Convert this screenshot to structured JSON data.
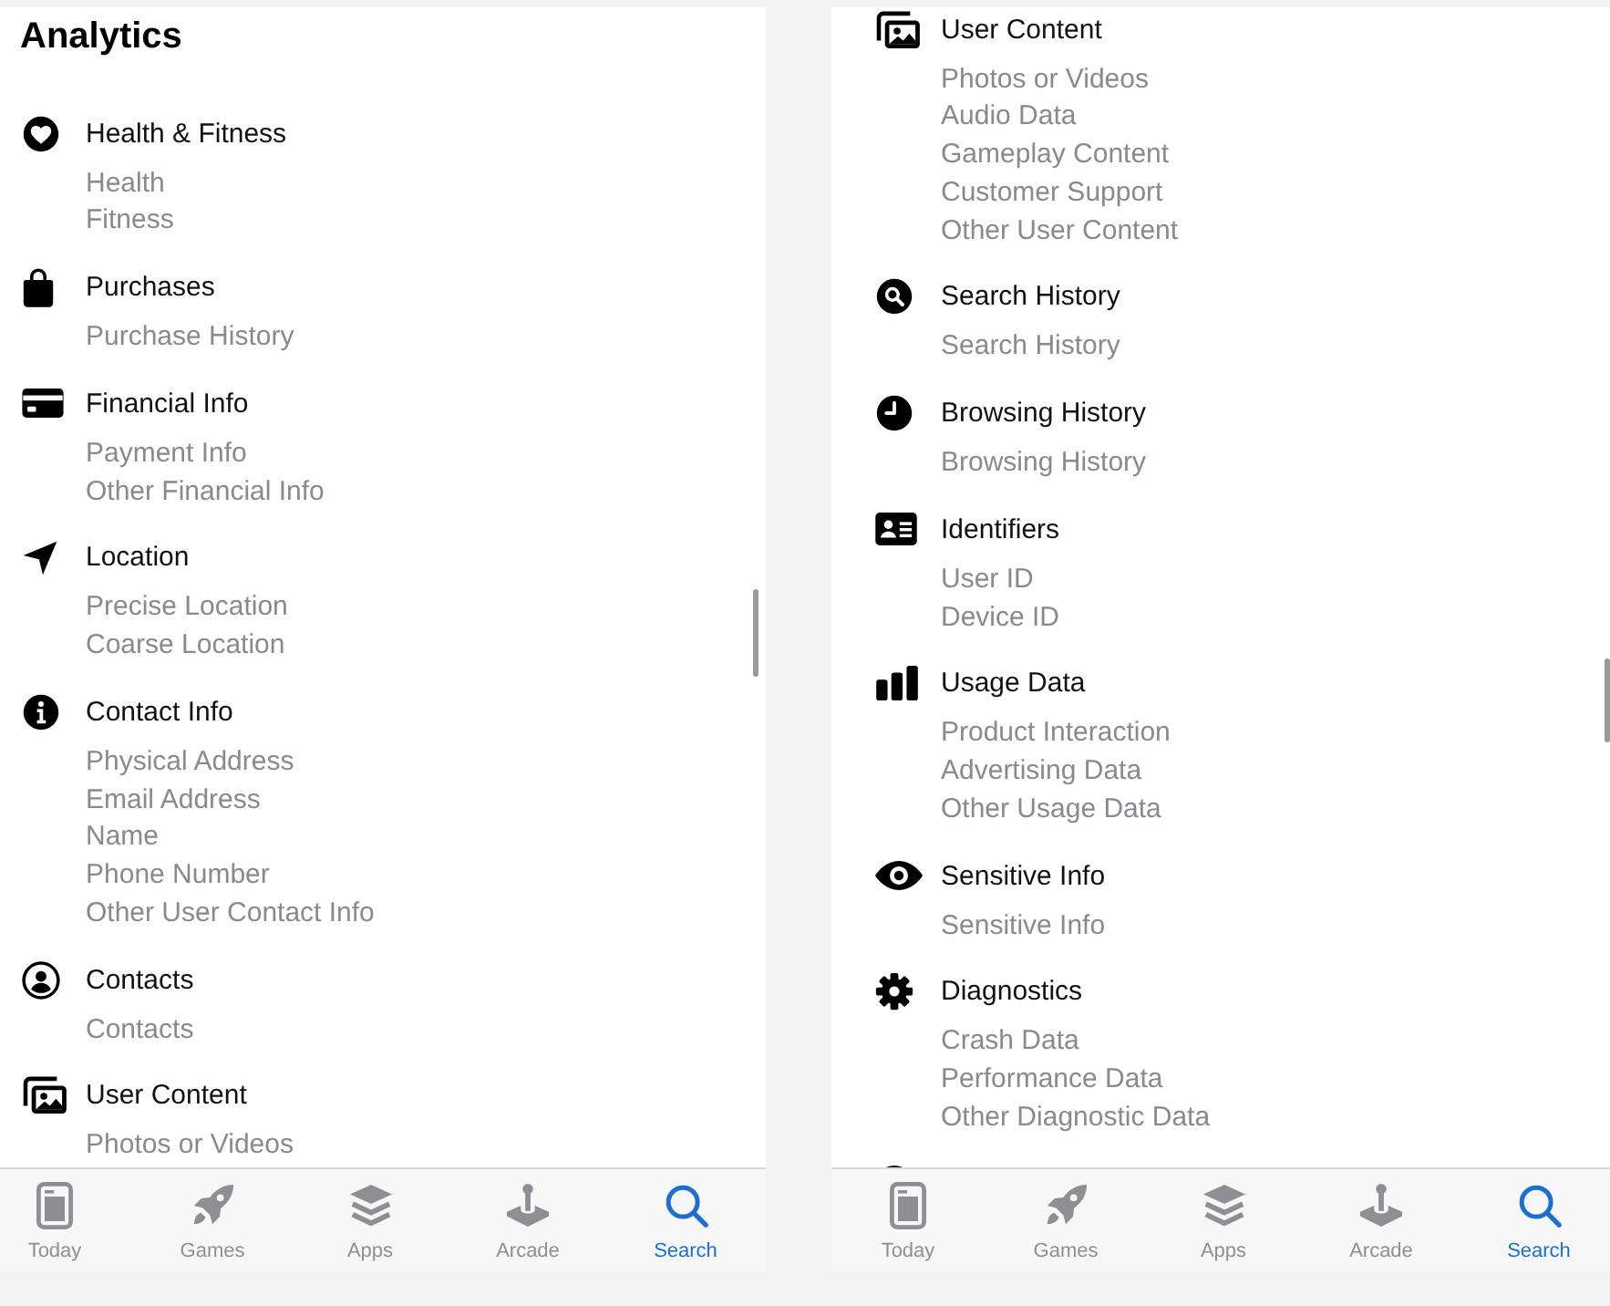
{
  "screens": [
    {
      "heading": "Analytics",
      "categories": [
        {
          "kind": "health",
          "title": "Health & Fitness",
          "items": [
            "Health",
            "Fitness"
          ]
        },
        {
          "kind": "purchases",
          "title": "Purchases",
          "items": [
            "Purchase History"
          ]
        },
        {
          "kind": "financial",
          "title": "Financial Info",
          "items": [
            "Payment Info",
            "Other Financial Info"
          ]
        },
        {
          "kind": "location",
          "title": "Location",
          "items": [
            "Precise Location",
            "Coarse Location"
          ]
        },
        {
          "kind": "contact",
          "title": "Contact Info",
          "items": [
            "Physical Address",
            "Email Address",
            "Name",
            "Phone Number",
            "Other User Contact Info"
          ]
        },
        {
          "kind": "contacts",
          "title": "Contacts",
          "items": [
            "Contacts"
          ]
        },
        {
          "kind": "content",
          "title": "User Content",
          "items": [
            "Photos or Videos"
          ]
        }
      ],
      "tab_bar": [
        {
          "kind": "today",
          "label": "Today",
          "selected": false
        },
        {
          "kind": "games",
          "label": "Games",
          "selected": false
        },
        {
          "kind": "apps",
          "label": "Apps",
          "selected": false
        },
        {
          "kind": "arcade",
          "label": "Arcade",
          "selected": false
        },
        {
          "kind": "search",
          "label": "Search",
          "selected": true
        }
      ]
    },
    {
      "categories": [
        {
          "kind": "content",
          "title": "User Content",
          "items": [
            "Photos or Videos",
            "Audio Data",
            "Gameplay Content",
            "Customer Support",
            "Other User Content"
          ]
        },
        {
          "kind": "search",
          "title": "Search History",
          "items": [
            "Search History"
          ]
        },
        {
          "kind": "browsing",
          "title": "Browsing History",
          "items": [
            "Browsing History"
          ]
        },
        {
          "kind": "identifiers",
          "title": "Identifiers",
          "items": [
            "User ID",
            "Device ID"
          ]
        },
        {
          "kind": "usage",
          "title": "Usage Data",
          "items": [
            "Product Interaction",
            "Advertising Data",
            "Other Usage Data"
          ]
        },
        {
          "kind": "sensitive",
          "title": "Sensitive Info",
          "items": [
            "Sensitive Info"
          ]
        },
        {
          "kind": "diagnostics",
          "title": "Diagnostics",
          "items": [
            "Crash Data",
            "Performance Data",
            "Other Diagnostic Data"
          ]
        },
        {
          "kind": "other"
        }
      ],
      "tab_bar": [
        {
          "kind": "today",
          "label": "Today",
          "selected": false
        },
        {
          "kind": "games",
          "label": "Games",
          "selected": false
        },
        {
          "kind": "apps",
          "label": "Apps",
          "selected": false
        },
        {
          "kind": "arcade",
          "label": "Arcade",
          "selected": false
        },
        {
          "kind": "search",
          "label": "Search",
          "selected": true
        }
      ]
    }
  ]
}
